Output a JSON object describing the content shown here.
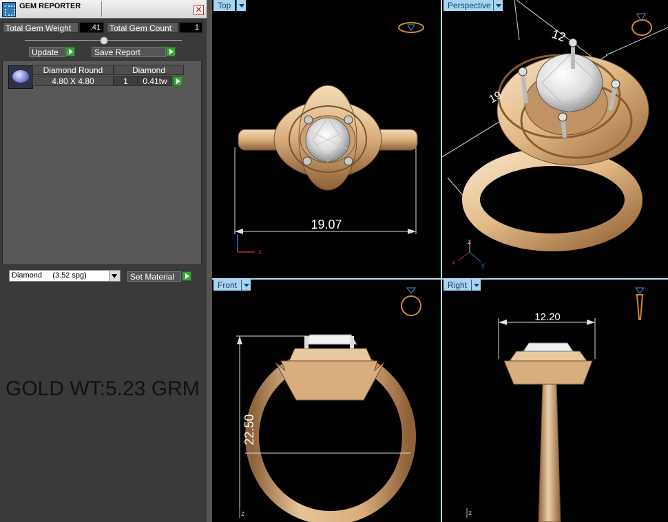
{
  "panel": {
    "title": "GEM REPORTER",
    "total_weight_label": "Total Gem Weight",
    "total_weight_value": ".41",
    "total_count_label": "Total Gem Count",
    "total_count_value": "1",
    "update_label": "Update",
    "save_report_label": "Save Report",
    "gem": {
      "name": "Diamond Round",
      "material": "Diamond",
      "size": "4.80 X 4.80",
      "count": "1",
      "weight": "0.41tw"
    },
    "material_select": "Diamond     (3.52 spg)",
    "set_material_label": "Set Material",
    "gold_weight": "GOLD WT:5.23 GRM"
  },
  "viewports": {
    "top": {
      "label": "Top",
      "dimension": "19.07"
    },
    "perspective": {
      "label": "Perspective",
      "dimension_a": "12",
      "dimension_b": "19"
    },
    "front": {
      "label": "Front",
      "dimension": "22.50"
    },
    "right": {
      "label": "Right",
      "dimension": "12.20"
    }
  },
  "axes": {
    "x": "x",
    "y": "y",
    "z": "z"
  },
  "colors": {
    "gold": "#e0b98a",
    "viewport_label_bg": "#a7d4ef",
    "panel_bg": "#3a3a3a",
    "accent_green": "#3ba335"
  }
}
